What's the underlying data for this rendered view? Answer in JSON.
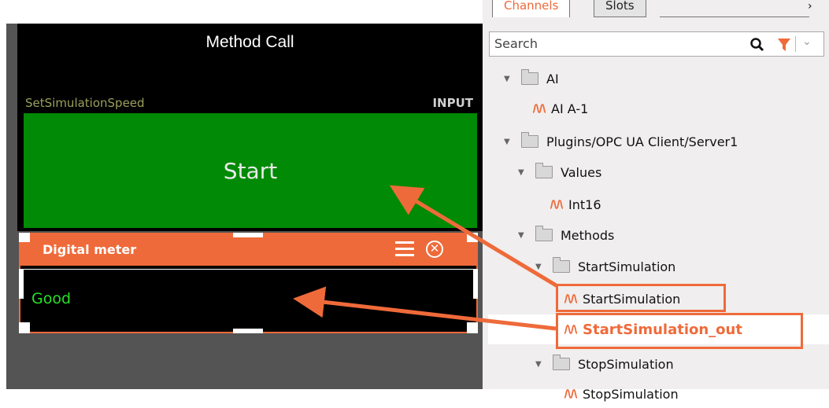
{
  "method_call": {
    "title": "Method Call",
    "method_name": "SetSimulationSpeed",
    "io_label": "INPUT",
    "button_label": "Start",
    "button_color": "#018a05"
  },
  "digital_meter": {
    "title": "Digital meter",
    "value": "Good",
    "menu_icon": "hamburger-icon",
    "close_icon": "close-circle-icon",
    "accent_color": "#ef6a3a",
    "value_color": "#25e025"
  },
  "panel": {
    "tabs": [
      {
        "label": "Channels",
        "active": true
      },
      {
        "label": "Slots",
        "active": false
      }
    ],
    "search_placeholder": "Search",
    "tree": [
      {
        "label": "AI",
        "type": "folder"
      },
      {
        "label": "AI A-1",
        "type": "channel"
      },
      {
        "label": "Plugins/OPC UA Client/Server1",
        "type": "folder"
      },
      {
        "label": "Values",
        "type": "folder"
      },
      {
        "label": "Int16",
        "type": "channel"
      },
      {
        "label": "Methods",
        "type": "folder"
      },
      {
        "label": "StartSimulation",
        "type": "folder"
      },
      {
        "label": "StartSimulation",
        "type": "channel"
      },
      {
        "label": "StartSimulation_out",
        "type": "channel"
      },
      {
        "label": "StopSimulation",
        "type": "folder"
      },
      {
        "label": "StopSimulation",
        "type": "channel"
      }
    ]
  }
}
